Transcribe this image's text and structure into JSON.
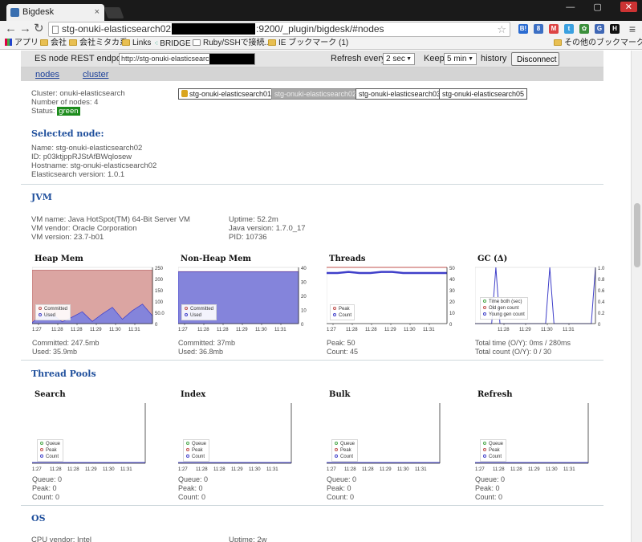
{
  "browser": {
    "tab_title": "Bigdesk",
    "tab_close": "×",
    "window_controls": "— ▢",
    "window_close": "✕",
    "url_prefix": "stg-onuki-elasticsearch02",
    "url_suffix": ":9200/_plugin/bigdesk/#nodes",
    "bookmarks": [
      "アプリ",
      "会社",
      "会社ミタカ系",
      "Links",
      "BRIDGE",
      "Ruby/SSHで接続...",
      "IE ブックマーク (1)",
      "その他のブックマーク"
    ],
    "extensions": [
      {
        "label": "B!",
        "color": "#2a6bd1"
      },
      {
        "label": "8",
        "color": "#3c6fc4"
      },
      {
        "label": "M",
        "color": "#d44"
      },
      {
        "label": "t",
        "color": "#3aa0e0"
      },
      {
        "label": "✿",
        "color": "#3b8f3b"
      },
      {
        "label": "G",
        "color": "#3f67b5"
      },
      {
        "label": "H",
        "color": "#111"
      }
    ]
  },
  "controls": {
    "endpoint_label": "ES node REST endpoint",
    "endpoint_value": "http://stg-onuki-elasticsearch02",
    "refresh_label": "Refresh every",
    "refresh_value": "2 sec",
    "keep_label": "Keep",
    "keep_value": "5 min",
    "history_label": "history",
    "disconnect_label": "Disconnect"
  },
  "nav": {
    "nodes": "nodes",
    "cluster": "cluster"
  },
  "cluster": {
    "name": "Cluster: onuki-elasticsearch",
    "nodes_count": "Number of nodes: 4",
    "status_label": "Status:",
    "status_value": "green",
    "status_color": "#1c8c1c"
  },
  "node_buttons": [
    "stg-onuki-elasticsearch01",
    "stg-onuki-elasticsearch02",
    "stg-onuki-elasticsearch03",
    "stg-onuki-elasticsearch05"
  ],
  "selected_node": {
    "title": "Selected node:",
    "name": "Name: stg-onuki-elasticsearch02",
    "id": "ID: p03ktjppRJStAfBWqlosew",
    "hostname": "Hostname: stg-onuki-elasticsearch02",
    "version": "Elasticsearch version: 1.0.1"
  },
  "jvm": {
    "title": "JVM",
    "vm_name": "VM name: Java HotSpot(TM) 64-Bit Server VM",
    "vm_vendor": "VM vendor: Oracle Corporation",
    "vm_version": "VM version: 23.7-b01",
    "uptime": "Uptime: 52.2m",
    "java_version": "Java version: 1.7.0_17",
    "pid": "PID: 10736"
  },
  "jvm_panels": [
    {
      "title": "Heap Mem",
      "stat1": "Committed: 247.5mb",
      "stat2": "Used: 35.9mb",
      "legend": [
        {
          "label": "Committed",
          "color": "#c0504d"
        },
        {
          "label": "Used",
          "color": "#3f3fc9"
        }
      ],
      "chart_data": {
        "type": "area",
        "x_ticks": [
          "1:27",
          "11:28",
          "11:28",
          "11:29",
          "11:30",
          "11:31"
        ],
        "y_ticks": [
          "250",
          "200",
          "150",
          "100",
          "50.0",
          "0"
        ],
        "ylim": [
          0,
          260
        ],
        "series": [
          {
            "name": "Committed",
            "values": [
              247,
              247,
              247,
              247,
              247,
              247,
              247,
              247,
              247,
              247,
              247,
              247,
              247
            ]
          },
          {
            "name": "Used",
            "values": [
              5,
              40,
              45,
              8,
              30,
              55,
              10,
              45,
              75,
              20,
              60,
              90,
              36
            ]
          }
        ]
      }
    },
    {
      "title": "Non-Heap Mem",
      "stat1": "Committed: 37mb",
      "stat2": "Used: 36.8mb",
      "legend": [
        {
          "label": "Committed",
          "color": "#c0504d"
        },
        {
          "label": "Used",
          "color": "#3f3fc9"
        }
      ],
      "chart_data": {
        "type": "area",
        "x_ticks": [
          "1:27",
          "11:28",
          "11:28",
          "11:29",
          "11:30",
          "11:31"
        ],
        "y_ticks": [
          "40",
          "30",
          "20",
          "10",
          "0"
        ],
        "ylim": [
          0,
          40
        ],
        "series": [
          {
            "name": "Committed",
            "values": [
              37,
              37,
              37,
              37,
              37,
              37,
              37,
              37,
              37,
              37
            ]
          },
          {
            "name": "Used",
            "values": [
              36.8,
              36.8,
              36.8,
              36.8,
              36.8,
              36.8,
              36.8,
              36.8,
              36.8,
              36.8
            ]
          }
        ]
      }
    },
    {
      "title": "Threads",
      "stat1": "Peak: 50",
      "stat2": "Count: 45",
      "legend": [
        {
          "label": "Peak",
          "color": "#c0504d"
        },
        {
          "label": "Count",
          "color": "#3f3fc9"
        }
      ],
      "chart_data": {
        "type": "line",
        "x_ticks": [
          "1:27",
          "11:28",
          "11:28",
          "11:29",
          "11:30",
          "11:31"
        ],
        "y_ticks": [
          "50",
          "40",
          "30",
          "20",
          "10",
          "0"
        ],
        "ylim": [
          0,
          50
        ],
        "series": [
          {
            "name": "Peak",
            "values": [
              50,
              50,
              50,
              50,
              50,
              50,
              50,
              50,
              50,
              50,
              50,
              50
            ]
          },
          {
            "name": "Count",
            "values": [
              45,
              45,
              46,
              45,
              45,
              46,
              46,
              45,
              45,
              45,
              45,
              45
            ]
          }
        ]
      }
    },
    {
      "title": "GC (Δ)",
      "stat1": "Total time (O/Y): 0ms / 280ms",
      "stat2": "Total count (O/Y): 0 / 30",
      "legend": [
        {
          "label": "Time both (sec)",
          "color": "#4aa84a"
        },
        {
          "label": "Old gen count",
          "color": "#c0504d"
        },
        {
          "label": "Young gen count",
          "color": "#3f3fc9"
        }
      ],
      "chart_data": {
        "type": "line",
        "x_ticks": [
          "11:28",
          "11:29",
          "11:30",
          "11:31"
        ],
        "y_ticks": [
          "1.0",
          "0.8",
          "0.6",
          "0.4",
          "0.2",
          "0"
        ],
        "ylim": [
          0,
          1.0
        ],
        "series": [
          {
            "name": "Young gen count",
            "values": [
              0,
              0,
              0,
              0,
              0,
              1,
              0,
              0,
              0,
              0,
              0,
              0,
              0,
              0,
              0,
              0,
              0,
              0,
              1,
              0,
              0,
              0,
              0,
              0,
              0,
              0,
              0,
              0,
              0,
              1
            ]
          }
        ]
      }
    }
  ],
  "thread_pools": {
    "title": "Thread Pools",
    "panels": [
      {
        "title": "Search",
        "stat1": "Queue: 0",
        "stat2": "Peak: 0",
        "stat3": "Count: 0"
      },
      {
        "title": "Index",
        "stat1": "Queue: 0",
        "stat2": "Peak: 0",
        "stat3": "Count: 0"
      },
      {
        "title": "Bulk",
        "stat1": "Queue: 0",
        "stat2": "Peak: 0",
        "stat3": "Count: 0"
      },
      {
        "title": "Refresh",
        "stat1": "Queue: 0",
        "stat2": "Peak: 0",
        "stat3": "Count: 0"
      }
    ],
    "legend": [
      {
        "label": "Queue",
        "color": "#4aa84a"
      },
      {
        "label": "Peak",
        "color": "#c0504d"
      },
      {
        "label": "Count",
        "color": "#3f3fc9"
      }
    ],
    "x_ticks": [
      "1:27",
      "11:28",
      "11:28",
      "11:29",
      "11:30",
      "11:31"
    ]
  },
  "os": {
    "title": "OS",
    "cpu_partial": "CPU vendor: Intel",
    "uptime_partial": "Uptime: 2w"
  }
}
